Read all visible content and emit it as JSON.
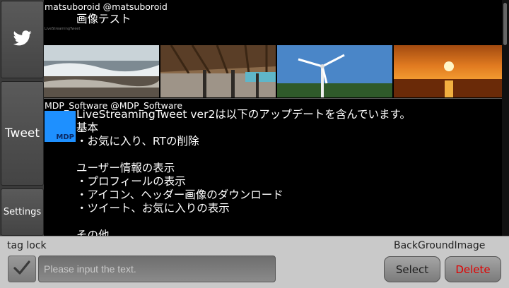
{
  "sidebar": {
    "twitter_icon": "twitter-bird-icon",
    "tweet_label": "Tweet",
    "settings_label": "Settings"
  },
  "timeline": {
    "tweets": [
      {
        "author": "matsuboroid @matsuboroid",
        "text": "画像テスト",
        "avatar_text": "LiveStreamingTweet",
        "media": [
          "beach-waves-photo",
          "pier-underside-photo",
          "wind-turbine-photo",
          "sunset-sea-photo"
        ]
      },
      {
        "author": "MDP_Software @MDP_Software",
        "avatar_label": "MDP",
        "text": "LiveStreamingTweet ver2は以下のアップデートを含んでいます。\n基本\n・お気に入り、RTの削除\n\nユーザー情報の表示\n・プロフィールの表示\n・アイコン、ヘッダー画像のダウンロード\n・ツイート、お気に入りの表示\n\nその他"
      }
    ]
  },
  "bottom_bar": {
    "tag_lock_label": "tag lock",
    "background_label": "BackGroundImage",
    "input_placeholder": "Please input the text.",
    "select_label": "Select",
    "delete_label": "Delete",
    "colors": {
      "delete_text": "#e00000",
      "avatar_blue": "#1e90ff"
    }
  }
}
